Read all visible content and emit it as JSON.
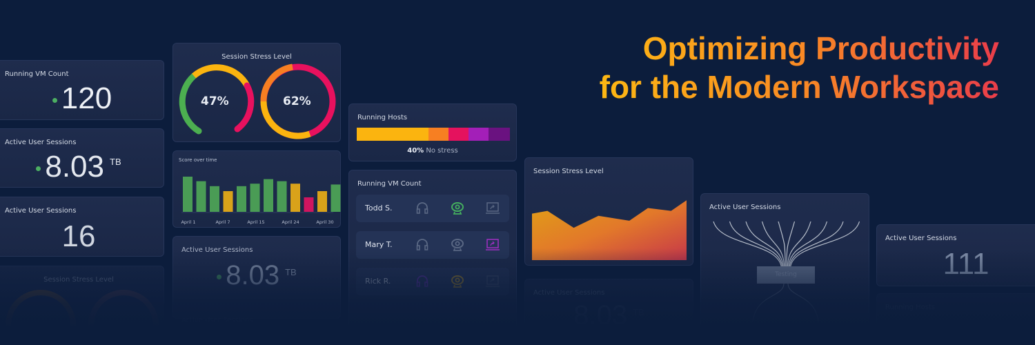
{
  "headline": {
    "line1": "Optimizing Productivity",
    "line2": "for the Modern Workspace"
  },
  "cards": {
    "vm_count": {
      "title": "Running VM Count",
      "value": "120"
    },
    "sessions_tb": {
      "title": "Active User Sessions",
      "value": "8.03",
      "unit": "TB"
    },
    "sessions_16": {
      "title": "Active User Sessions",
      "value": "16"
    },
    "stress_faded": {
      "title": "Session Stress Level"
    },
    "stress_gauges": {
      "title": "Session Stress Level",
      "gauges": [
        {
          "value": "47%"
        },
        {
          "value": "62%"
        }
      ]
    },
    "score": {
      "title": "Score over time"
    },
    "sessions_tb2": {
      "title": "Active User Sessions",
      "value": "8.03",
      "unit": "TB"
    },
    "sessions_faded_label": {
      "title": "Active User Sessions"
    },
    "running_hosts": {
      "title": "Running Hosts",
      "percent": "40%",
      "status": "No stress",
      "segments": [
        {
          "share": 47,
          "color": "#fbb40f"
        },
        {
          "share": 13,
          "color": "#f77f22"
        },
        {
          "share": 13,
          "color": "#e5125e"
        },
        {
          "share": 13,
          "color": "#a31fb8"
        },
        {
          "share": 14,
          "color": "#6a1280"
        }
      ]
    },
    "vm_list": {
      "title": "Running VM Count",
      "rows": [
        {
          "name": "Todd S.",
          "headphones": "#5a6884",
          "webcam": "#45b05f",
          "screen": "#5a6884"
        },
        {
          "name": "Mary T.",
          "headphones": "#5a6884",
          "webcam": "#5a6884",
          "screen": "#a12fc4"
        },
        {
          "name": "Rick R.",
          "headphones": "#6a2fb0",
          "webcam": "#c89a18",
          "screen": "#44506c"
        }
      ]
    },
    "stress_area": {
      "title": "Session Stress Level"
    },
    "sessions_tb3": {
      "title": "Active User Sessions",
      "value": "8.03",
      "unit": "TB"
    },
    "sankey": {
      "title": "Active User Sessions",
      "node": "Testing"
    },
    "sessions_111": {
      "title": "Active User Sessions",
      "value": "111"
    },
    "hosts_faded": {
      "title": "Running Hosts"
    }
  },
  "chart_data": [
    {
      "type": "bar",
      "title": "Score over time",
      "categories": [
        "April 1",
        "",
        "",
        "April 7",
        "",
        "",
        "April 15",
        "",
        "",
        "April 24",
        "",
        "April 30"
      ],
      "tick_labels": [
        "April 1",
        "April 7",
        "April 15",
        "April 24",
        "April 30"
      ],
      "values": [
        85,
        74,
        62,
        50,
        62,
        68,
        79,
        74,
        68,
        35,
        50,
        66
      ],
      "colors": [
        "#4a9c55",
        "#4a9c55",
        "#4a9c55",
        "#d9a21a",
        "#4a9c55",
        "#4a9c55",
        "#4a9c55",
        "#4a9c55",
        "#d9a21a",
        "#d0155f",
        "#d9a21a",
        "#4a9c55"
      ]
    },
    {
      "type": "area",
      "title": "Session Stress Level",
      "values": [
        66,
        70,
        46,
        63,
        56,
        74,
        70,
        85
      ]
    }
  ]
}
